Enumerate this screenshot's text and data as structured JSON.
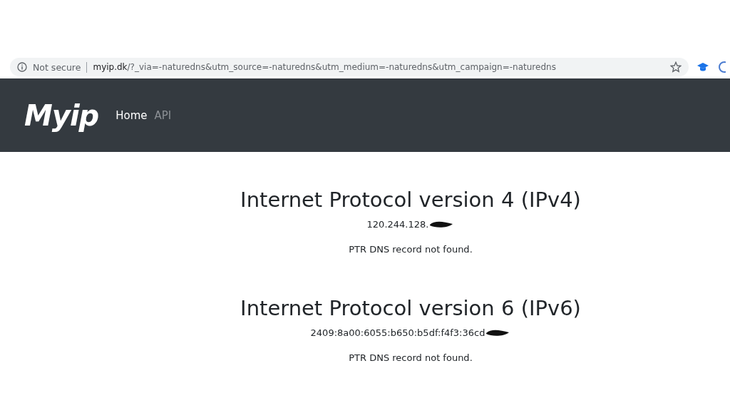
{
  "browser": {
    "security": "Not secure",
    "url_host": "myip.dk",
    "url_path": "/?_via=-naturedns&utm_source=-naturedns&utm_medium=-naturedns&utm_campaign=-naturedns"
  },
  "navbar": {
    "logo": "Myip",
    "links": [
      {
        "label": "Home",
        "selected": true
      },
      {
        "label": "API",
        "selected": false
      }
    ]
  },
  "sections": [
    {
      "title": "Internet Protocol version 4 (IPv4)",
      "address": "120.244.128.",
      "ptr": "PTR DNS record not found."
    },
    {
      "title": "Internet Protocol version 6 (IPv6)",
      "address": "2409:8a00:6055:b650:b5df:f4f3:36cd",
      "ptr": "PTR DNS record not found."
    }
  ]
}
